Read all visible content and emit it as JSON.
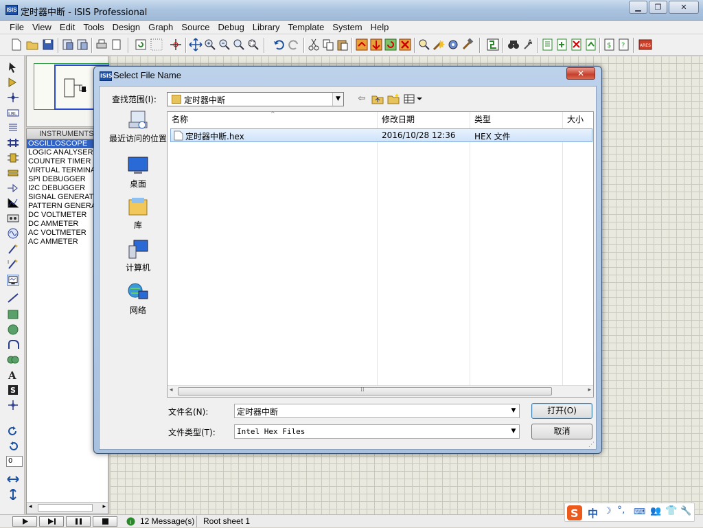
{
  "window": {
    "title": "定时器中断 - ISIS Professional",
    "app_icon": "ISIS"
  },
  "menu": [
    "File",
    "View",
    "Edit",
    "Tools",
    "Design",
    "Graph",
    "Source",
    "Debug",
    "Library",
    "Template",
    "System",
    "Help"
  ],
  "instruments": {
    "header": "INSTRUMENTS",
    "items": [
      "OSCILLOSCOPE",
      "LOGIC ANALYSER",
      "COUNTER TIMER",
      "VIRTUAL TERMINAL",
      "SPI DEBUGGER",
      "I2C DEBUGGER",
      "SIGNAL GENERATOR",
      "PATTERN GENERATOR",
      "DC VOLTMETER",
      "DC AMMETER",
      "AC VOLTMETER",
      "AC AMMETER"
    ],
    "selected_index": 0
  },
  "rotation_value": "0",
  "status": {
    "messages": "12 Message(s)",
    "sheet": "Root sheet 1"
  },
  "dialog": {
    "title": "Select File Name",
    "close_label": "✕",
    "look_in_label": "查找范围(I):",
    "look_in_value": "定时器中断",
    "places": [
      "最近访问的位置",
      "桌面",
      "库",
      "计算机",
      "网络"
    ],
    "columns": [
      "名称",
      "修改日期",
      "类型",
      "大小"
    ],
    "files": [
      {
        "name": "定时器中断.hex",
        "modified": "2016/10/28 12:36",
        "type": "HEX 文件",
        "size": ""
      }
    ],
    "filename_label": "文件名(N):",
    "filename_value": "定时器中断",
    "filetype_label": "文件类型(T):",
    "filetype_value": "Intel Hex Files",
    "open_button": "打开(O)",
    "cancel_button": "取消"
  },
  "ime": {
    "label": "中"
  },
  "colors": {
    "accent": "#3163c6",
    "title_bar": "#a9c3df",
    "canvas": "#e9e9df",
    "grid": "#c8c8bc"
  }
}
